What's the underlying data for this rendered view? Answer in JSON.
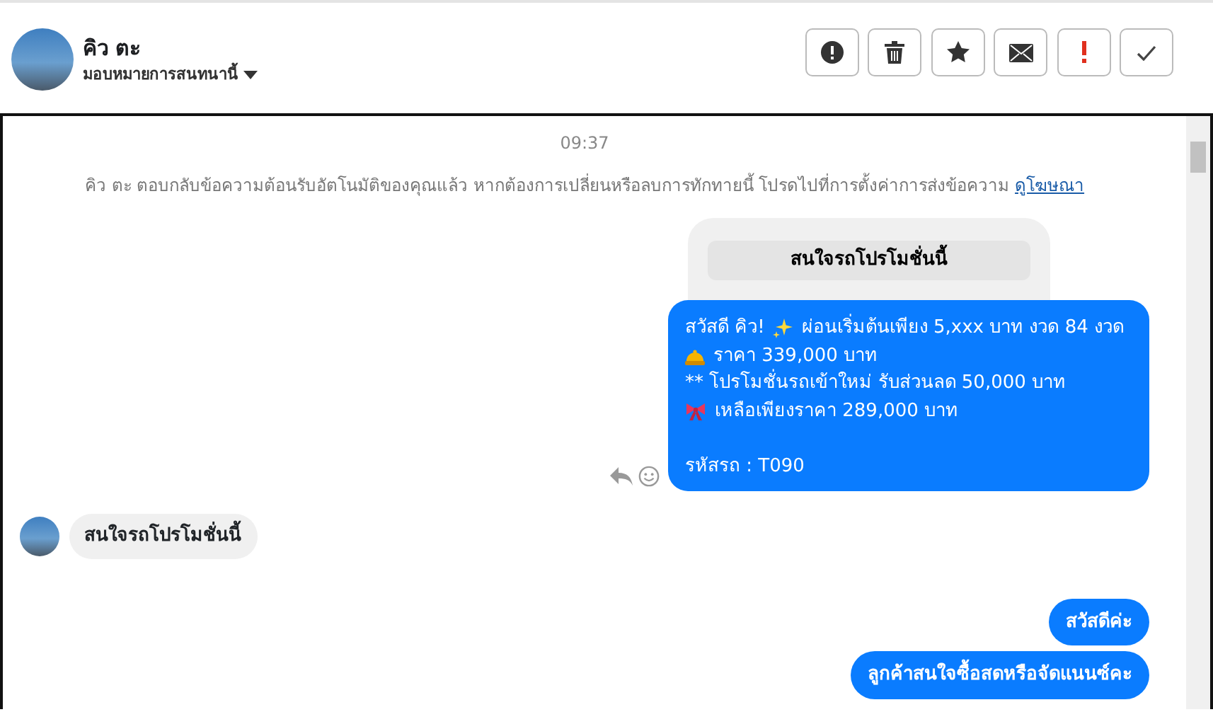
{
  "header": {
    "name": "คิว ตะ",
    "assign": "มอบหมายการสนทนานี้"
  },
  "actions": [
    {
      "kind": "alert"
    },
    {
      "kind": "trash"
    },
    {
      "kind": "star"
    },
    {
      "kind": "mail"
    },
    {
      "kind": "important"
    },
    {
      "kind": "check"
    }
  ],
  "chat": {
    "time": "09:37",
    "notice": "คิว ตะ ตอบกลับข้อความต้อนรับอัตโนมัติของคุณแล้ว หากต้องการเปลี่ยนหรือลบการทักทายนี้ โปรดไปที่การตั้งค่าการส่งข้อความ",
    "notice_link": "ดูโฆษณา",
    "card_button": "สนใจรถโปรโมชั่นนี้",
    "promo_lines": [
      {
        "kind": "line",
        "parts": [
          {
            "kind": "text",
            "text": "สวัสดี คิว!"
          },
          {
            "kind": "sparkle"
          },
          {
            "kind": "text",
            "text": "ผ่อนเริ่มต้นเพียง 5,xxx บาท งวด 84 งวด"
          }
        ]
      },
      {
        "kind": "line",
        "parts": [
          {
            "kind": "bell"
          },
          {
            "kind": "text",
            "text": "ราคา 339,000 บาท"
          }
        ]
      },
      {
        "kind": "line",
        "parts": [
          {
            "kind": "text",
            "text": "** โปรโมชั่นรถเข้าใหม่ รับส่วนลด 50,000 บาท"
          }
        ]
      },
      {
        "kind": "line",
        "parts": [
          {
            "kind": "bow"
          },
          {
            "kind": "text",
            "text": "เหลือเพียงราคา 289,000 บาท"
          }
        ]
      },
      {
        "kind": "blank"
      },
      {
        "kind": "line",
        "parts": [
          {
            "kind": "text",
            "text": "รหัสรถ : T090"
          }
        ]
      }
    ],
    "messages": [
      {
        "kind": "received",
        "text": "สนใจรถโปรโมชั่นนี้"
      },
      {
        "kind": "sent",
        "text": "สวัสดีค่ะ"
      },
      {
        "kind": "sent",
        "text": "ลูกค้าสนใจซื้อสดหรือจัดแนนซ์คะ"
      }
    ]
  }
}
